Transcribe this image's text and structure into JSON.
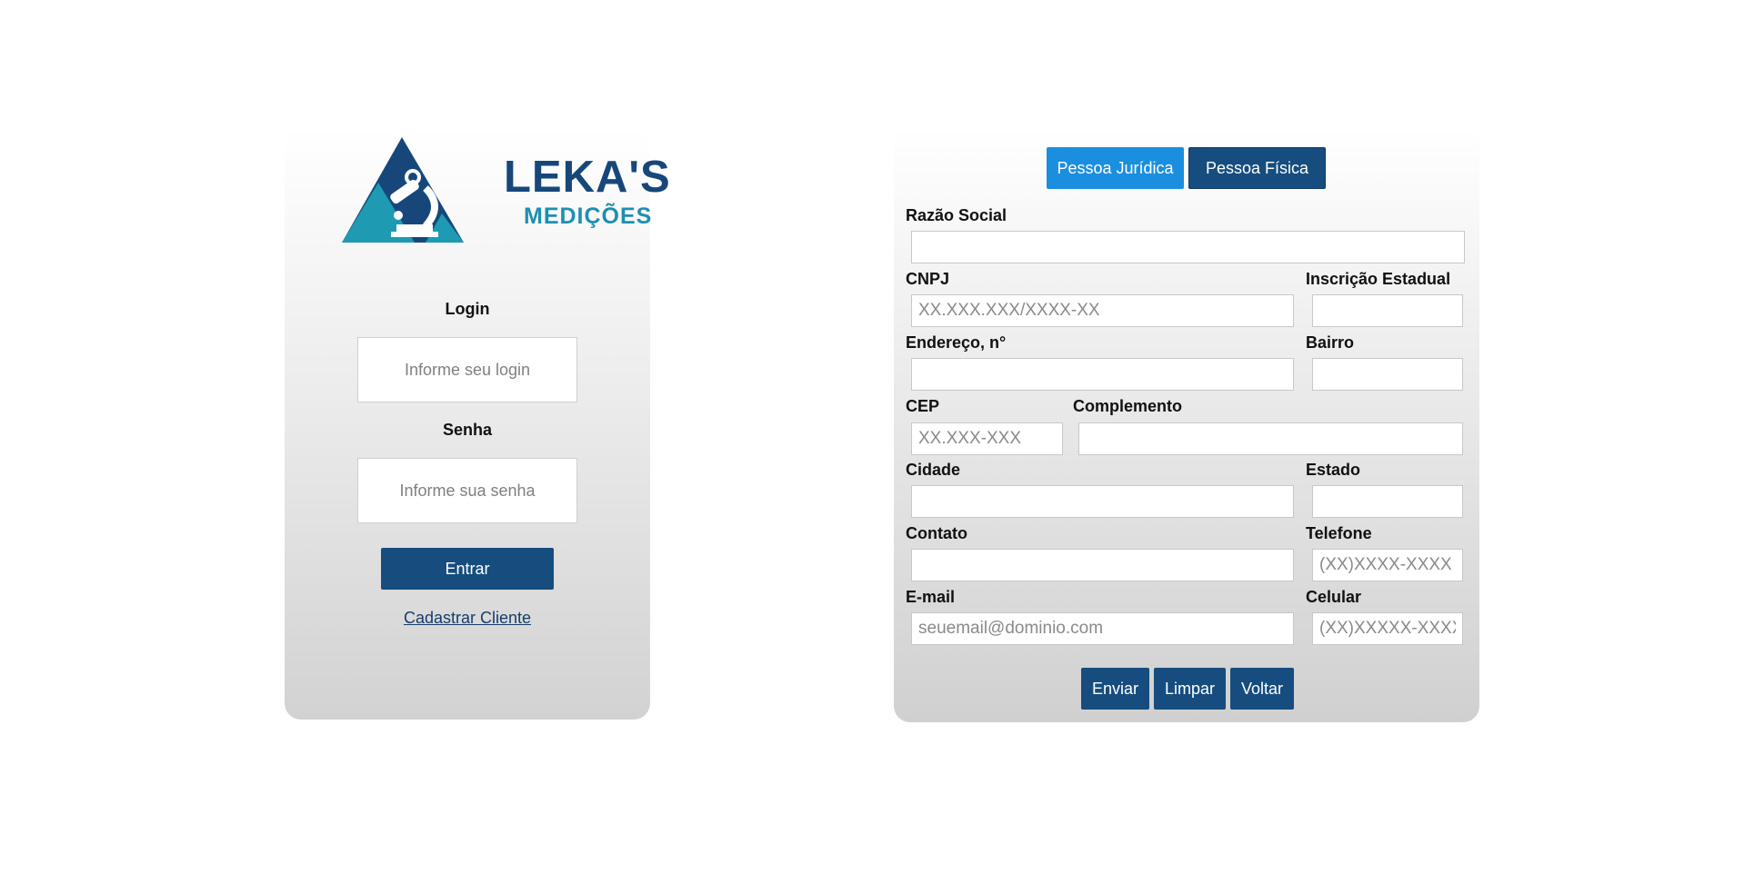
{
  "login": {
    "logo": {
      "brand": "LEKA'S",
      "subtitle": "MEDIÇÕES"
    },
    "login_label": "Login",
    "login_placeholder": "Informe seu login",
    "password_label": "Senha",
    "password_placeholder": "Informe sua senha",
    "submit_label": "Entrar",
    "register_link": "Cadastrar Cliente"
  },
  "register": {
    "tabs": [
      {
        "label": "Pessoa Jurídica",
        "active": true
      },
      {
        "label": "Pessoa Física",
        "active": false
      }
    ],
    "fields": {
      "razao_social": {
        "label": "Razão Social",
        "placeholder": ""
      },
      "cnpj": {
        "label": "CNPJ",
        "placeholder": "XX.XXX.XXX/XXXX-XX"
      },
      "inscricao": {
        "label": "Inscrição Estadual",
        "placeholder": ""
      },
      "endereco": {
        "label": "Endereço, n°",
        "placeholder": ""
      },
      "bairro": {
        "label": "Bairro",
        "placeholder": ""
      },
      "cep": {
        "label": "CEP",
        "placeholder": "XX.XXX-XXX"
      },
      "complemento": {
        "label": "Complemento",
        "placeholder": ""
      },
      "cidade": {
        "label": "Cidade",
        "placeholder": ""
      },
      "estado": {
        "label": "Estado",
        "placeholder": ""
      },
      "contato": {
        "label": "Contato",
        "placeholder": ""
      },
      "telefone": {
        "label": "Telefone",
        "placeholder": "(XX)XXXX-XXXX"
      },
      "email": {
        "label": "E-mail",
        "placeholder": "seuemail@dominio.com"
      },
      "celular": {
        "label": "Celular",
        "placeholder": "(XX)XXXXX-XXXX"
      }
    },
    "actions": {
      "send": "Enviar",
      "clear": "Limpar",
      "back": "Voltar"
    }
  },
  "colors": {
    "primary": "#164d7e",
    "tab_active": "#1a8fe0",
    "logo_dark": "#17477a",
    "logo_teal": "#1e8fb1"
  },
  "icons": {
    "logo_mark": "microscope-triangle-icon"
  }
}
